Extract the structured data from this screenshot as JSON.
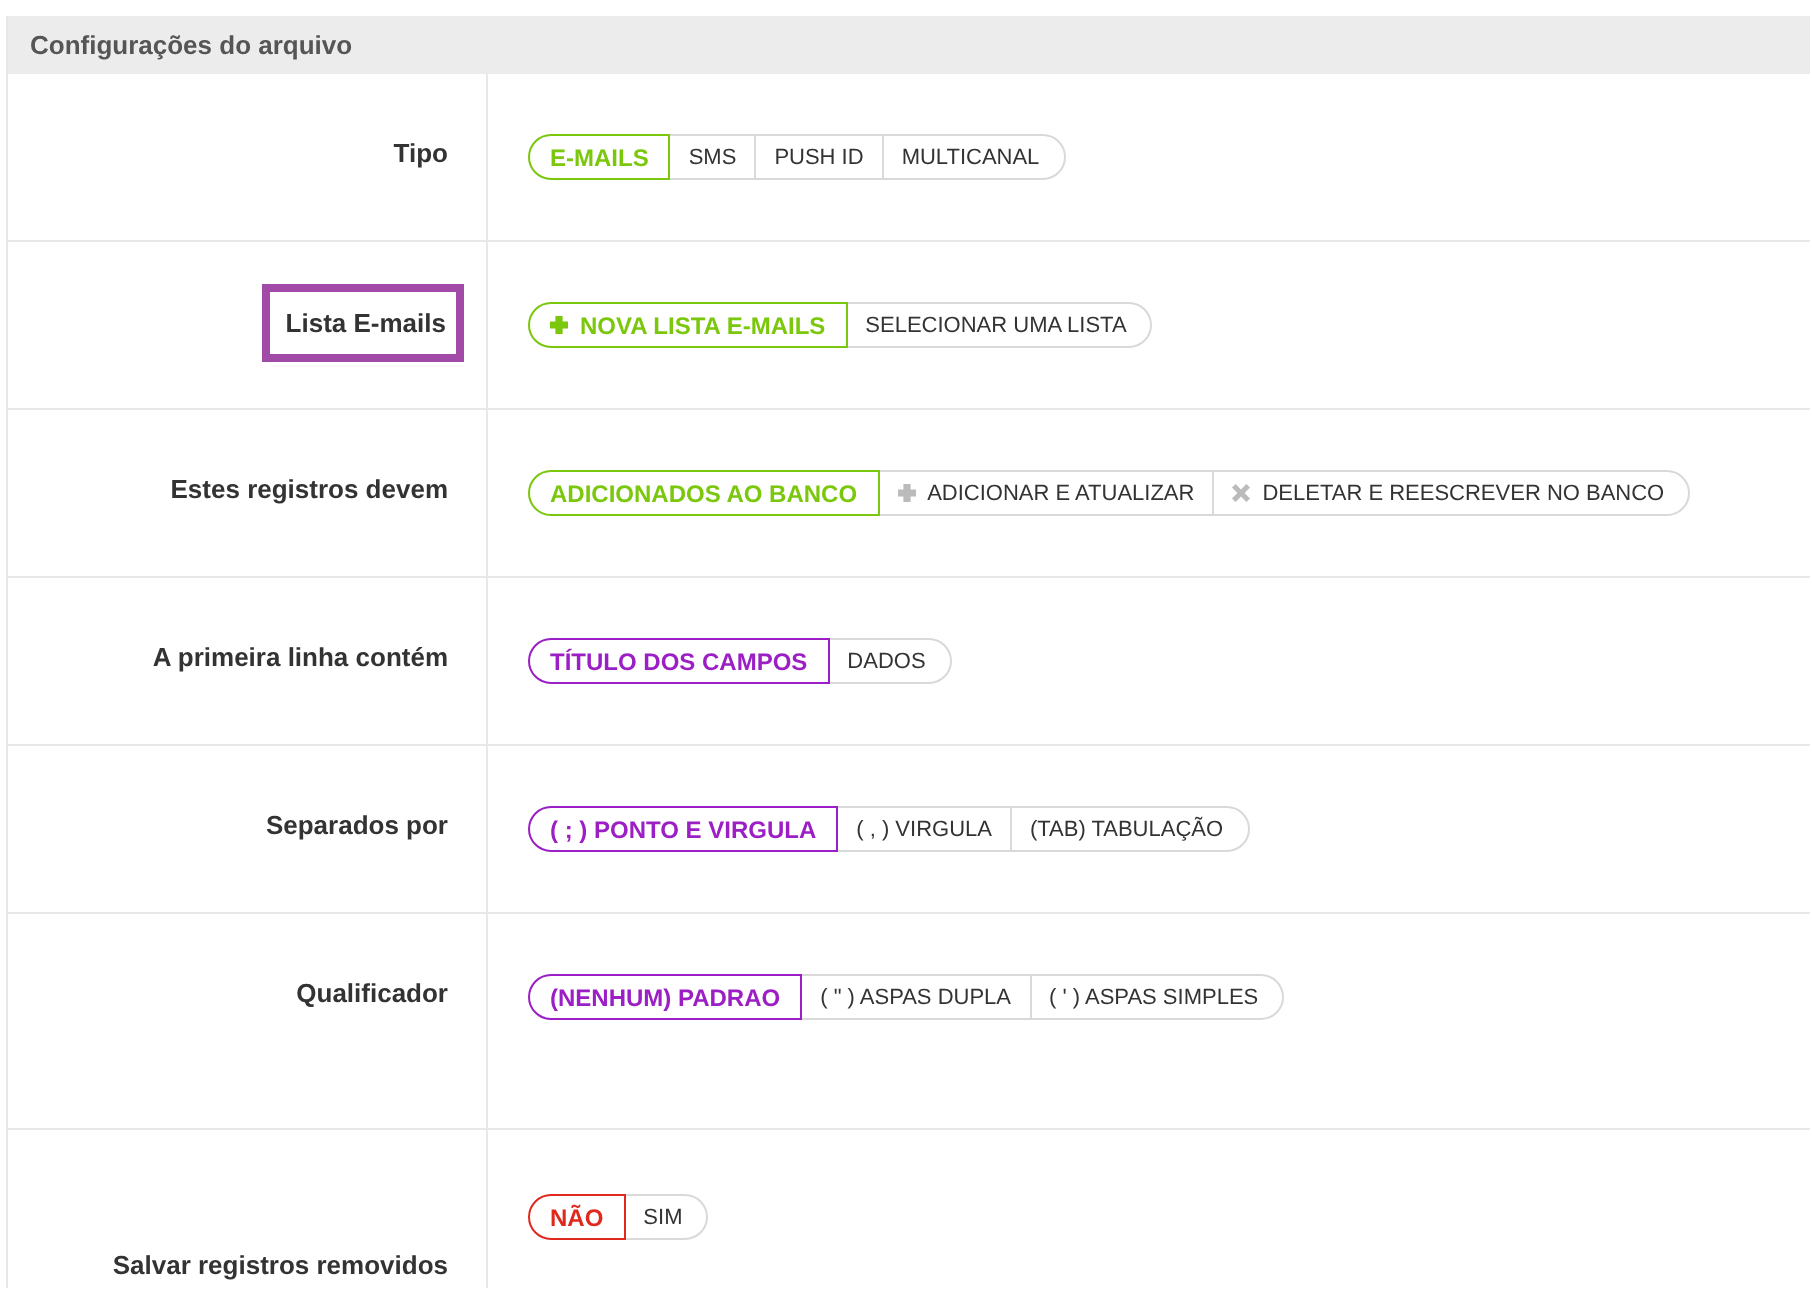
{
  "panel": {
    "title": "Configurações do arquivo"
  },
  "rows": [
    {
      "label": "Tipo",
      "highlighted": false,
      "color": "#7ac70c",
      "options": [
        {
          "label": "E-MAILS",
          "selected": true,
          "kind": "plain"
        },
        {
          "label": "SMS",
          "selected": false,
          "kind": "plain"
        },
        {
          "label": "PUSH ID",
          "selected": false,
          "kind": "plain"
        },
        {
          "label": "MULTICANAL",
          "selected": false,
          "kind": "plain"
        }
      ]
    },
    {
      "label": "Lista E-mails",
      "highlighted": true,
      "color": "#7ac70c",
      "options": [
        {
          "label": "NOVA LISTA E-MAILS",
          "selected": true,
          "kind": "plus"
        },
        {
          "label": "SELECIONAR UMA LISTA",
          "selected": false,
          "kind": "plain"
        }
      ]
    },
    {
      "label": "Estes registros devem",
      "highlighted": false,
      "color": "#7ac70c",
      "options": [
        {
          "label": "ADICIONADOS AO BANCO",
          "selected": true,
          "kind": "plain"
        },
        {
          "label": "ADICIONAR E ATUALIZAR",
          "selected": false,
          "kind": "plus"
        },
        {
          "label": "DELETAR E REESCREVER NO BANCO",
          "selected": false,
          "kind": "cross"
        }
      ]
    },
    {
      "label": "A primeira linha contém",
      "highlighted": false,
      "color": "#9b1fc4",
      "options": [
        {
          "label": "TÍTULO DOS CAMPOS",
          "selected": true,
          "kind": "plain"
        },
        {
          "label": "DADOS",
          "selected": false,
          "kind": "plain"
        }
      ]
    },
    {
      "label": "Separados por",
      "highlighted": false,
      "color": "#9b1fc4",
      "options": [
        {
          "label": "( ; ) PONTO E VIRGULA",
          "selected": true,
          "kind": "plain"
        },
        {
          "label": "( , ) VIRGULA",
          "selected": false,
          "kind": "plain"
        },
        {
          "label": "(TAB) TABULAÇÃO",
          "selected": false,
          "kind": "plain"
        }
      ]
    },
    {
      "label": "Qualificador",
      "highlighted": false,
      "color": "#9b1fc4",
      "options": [
        {
          "label": "(NENHUM) PADRAO",
          "selected": true,
          "kind": "plain"
        },
        {
          "label": "( \" ) ASPAS DUPLA",
          "selected": false,
          "kind": "plain"
        },
        {
          "label": "( ' ) ASPAS SIMPLES",
          "selected": false,
          "kind": "plain"
        }
      ]
    },
    {
      "label": "Salvar registros removidos",
      "highlighted": false,
      "color": "#e0281c",
      "options": [
        {
          "label": "NÃO",
          "selected": true,
          "kind": "plain"
        },
        {
          "label": "SIM",
          "selected": false,
          "kind": "plain"
        }
      ]
    }
  ]
}
